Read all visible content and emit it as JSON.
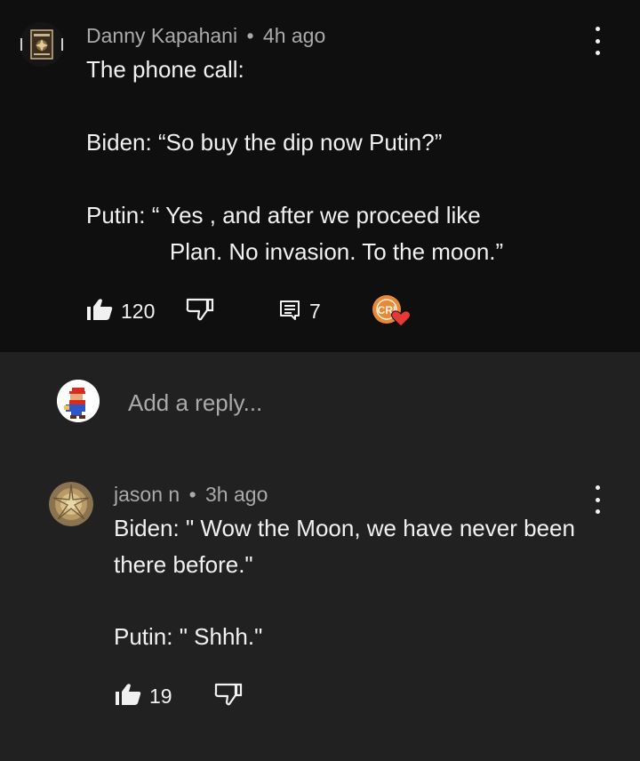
{
  "top_comment": {
    "author": "Danny Kapahani",
    "separator": "•",
    "time": "4h ago",
    "lines": [
      "The phone call:",
      "",
      "Biden: “So buy the dip now Putin?”",
      "",
      "Putin: “ Yes , and after we proceed like",
      "             Plan. No invasion. To the moon.”"
    ],
    "likes": "120",
    "replies": "7",
    "creator_badge_text": "CRI"
  },
  "reply_box": {
    "placeholder": "Add a reply..."
  },
  "reply_comment": {
    "author": "jason n",
    "separator": "•",
    "time": "3h ago",
    "lines": [
      "Biden: \" Wow the Moon, we have never been",
      "there before.\"",
      "",
      "Putin: \" Shhh.\""
    ],
    "likes": "19"
  },
  "icons": {
    "like": "thumbs-up-icon",
    "dislike": "thumbs-down-icon",
    "reply": "reply-comment-icon",
    "more": "more-vertical-icon",
    "heart": "heart-icon"
  },
  "colors": {
    "top_bg": "#0f0f0f",
    "bottom_bg": "#212121",
    "text": "#f1f1f1",
    "meta": "#aaaaaa",
    "heart": "#e53935"
  }
}
